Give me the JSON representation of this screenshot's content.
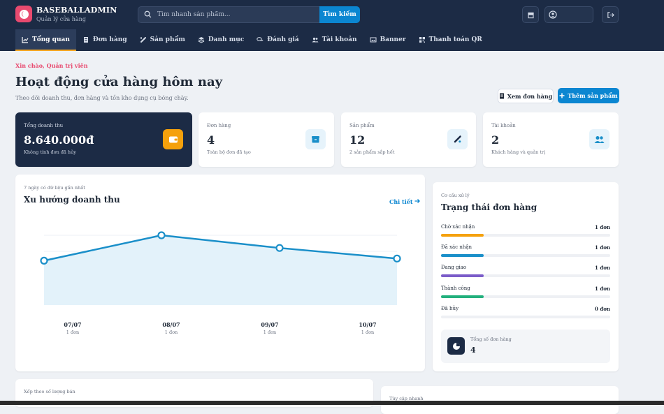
{
  "brand": {
    "name": "BASEBALLADMIN",
    "sub": "Quản lý cửa hàng"
  },
  "search": {
    "placeholder": "Tìm nhanh sản phẩm...",
    "button": "Tìm kiếm"
  },
  "nav": [
    {
      "label": "Tổng quan",
      "icon": "chart-line-icon",
      "active": true
    },
    {
      "label": "Đơn hàng",
      "icon": "receipt-icon"
    },
    {
      "label": "Sản phẩm",
      "icon": "baseball-bat-icon"
    },
    {
      "label": "Danh mục",
      "icon": "layers-icon"
    },
    {
      "label": "Đánh giá",
      "icon": "comments-icon"
    },
    {
      "label": "Tài khoản",
      "icon": "users-icon"
    },
    {
      "label": "Banner",
      "icon": "image-icon"
    },
    {
      "label": "Thanh toán QR",
      "icon": "qr-icon"
    }
  ],
  "header": {
    "greeting": "Xin chào, Quản trị viên",
    "title": "Hoạt động cửa hàng hôm nay",
    "subtitle": "Theo dõi doanh thu, đơn hàng và tồn kho dụng cụ bóng chày.",
    "view_orders": "Xem đơn hàng",
    "add_product": "Thêm sản phẩm"
  },
  "kpis": [
    {
      "label": "Tổng doanh thu",
      "value": "8.640.000đ",
      "note": "Không tính đơn đã hủy",
      "icon": "wallet-icon"
    },
    {
      "label": "Đơn hàng",
      "value": "4",
      "note": "Toàn bộ đơn đã tạo",
      "icon": "box-icon"
    },
    {
      "label": "Sản phẩm",
      "value": "12",
      "note": "2 sản phẩm sắp hết",
      "icon": "baseball-bat-icon"
    },
    {
      "label": "Tài khoản",
      "value": "2",
      "note": "Khách hàng và quản trị",
      "icon": "users-icon"
    }
  ],
  "revenue": {
    "caption": "7 ngày có dữ liệu gần nhất",
    "title": "Xu hướng doanh thu",
    "detail": "Chi tiết",
    "labels": [
      "07/07",
      "08/07",
      "09/07",
      "10/07"
    ],
    "subs": [
      "1 đơn",
      "1 đơn",
      "1 đơn",
      "1 đơn"
    ]
  },
  "chart_data": {
    "type": "area",
    "categories": [
      "07/07",
      "08/07",
      "09/07",
      "10/07"
    ],
    "values": [
      2.1,
      3.3,
      2.7,
      2.2
    ],
    "title": "Xu hướng doanh thu",
    "ylim": [
      0,
      3.3
    ],
    "grid": true,
    "color": "#1a8fc9",
    "fill": "#e3f2fa"
  },
  "status": {
    "caption": "Cơ cấu xử lý",
    "title": "Trạng thái đơn hàng",
    "items": [
      {
        "name": "Chờ xác nhận",
        "value": "1 đơn",
        "fraction": 0.25,
        "color": "#f5a10c"
      },
      {
        "name": "Đã xác nhận",
        "value": "1 đơn",
        "fraction": 0.25,
        "color": "#1a8fc9"
      },
      {
        "name": "Đang giao",
        "value": "1 đơn",
        "fraction": 0.25,
        "color": "#7b5cc9"
      },
      {
        "name": "Thành công",
        "value": "1 đơn",
        "fraction": 0.25,
        "color": "#22b07d"
      },
      {
        "name": "Đã hủy",
        "value": "0 đơn",
        "fraction": 0,
        "color": "#e84a6f"
      }
    ],
    "total_label": "Tổng số đơn hàng",
    "total_value": "4"
  },
  "bottom": {
    "left_caption": "Xếp theo số lượng bán",
    "right_caption": "Tùy cập nhanh"
  }
}
